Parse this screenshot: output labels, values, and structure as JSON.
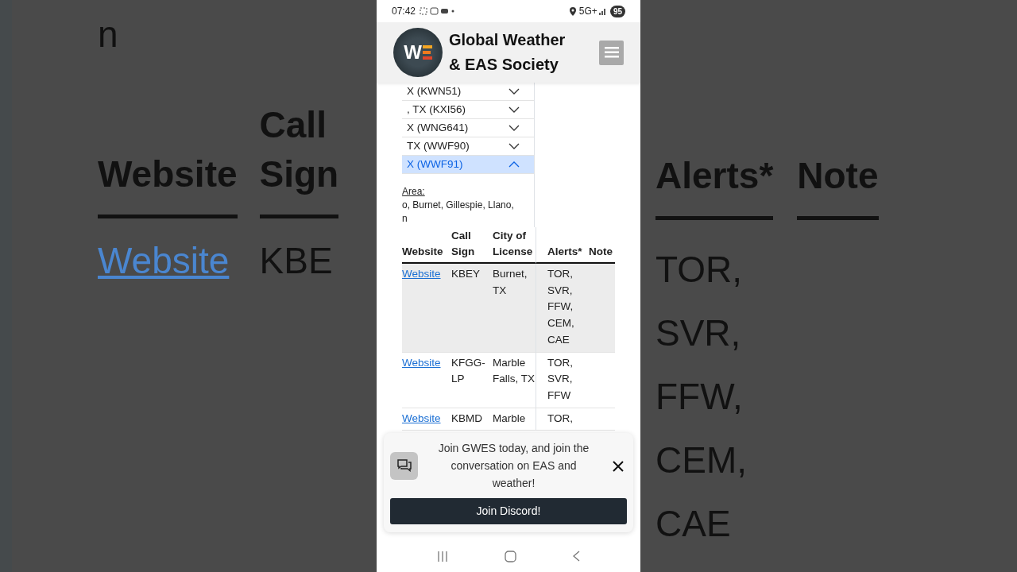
{
  "backdrop_left": {
    "fragment": "n",
    "columns": [
      {
        "header_lines": [
          "Website"
        ],
        "cell": "Website",
        "link": true
      },
      {
        "header_lines": [
          "Call",
          "Sign"
        ],
        "cell": "KBE",
        "link": false
      }
    ]
  },
  "backdrop_right": {
    "columns": [
      {
        "header": "Alerts*",
        "cell_lines": [
          "TOR,",
          "SVR,",
          "FFW,",
          "CEM,",
          "CAE"
        ]
      },
      {
        "header": "Note"
      }
    ]
  },
  "status_bar": {
    "time": "07:42",
    "network": "5G+",
    "battery": "95"
  },
  "header": {
    "logo_letter": "W",
    "title_lines": [
      "Global Weather",
      "& EAS Society"
    ]
  },
  "accordion": [
    {
      "label": "X (KWN51)",
      "expanded": false
    },
    {
      "label": ", TX (KXI56)",
      "expanded": false
    },
    {
      "label": "X (WNG641)",
      "expanded": false
    },
    {
      "label": "TX (WWF90)",
      "expanded": false
    },
    {
      "label": "X (WWF91)",
      "expanded": true
    }
  ],
  "area": {
    "label": "Area:",
    "lines": [
      "o, Burnet, Gillespie, Llano,",
      "n"
    ]
  },
  "table": {
    "columns": [
      "Website",
      "Call Sign",
      "City of License",
      "Alerts*",
      "Note"
    ],
    "rows": [
      {
        "website": "Website",
        "call_sign_lines": [
          "KBEY"
        ],
        "city_lines": [
          "Burnet,",
          "TX"
        ],
        "alerts_lines": [
          "TOR,",
          "SVR,",
          "FFW,",
          "CEM,",
          "CAE"
        ],
        "shaded": true
      },
      {
        "website": "Website",
        "call_sign_lines": [
          "KFGG-",
          "LP"
        ],
        "city_lines": [
          "Marble",
          "Falls, TX"
        ],
        "alerts_lines": [
          "TOR,",
          "SVR,",
          "FFW"
        ],
        "shaded": false
      },
      {
        "website": "Website",
        "call_sign_lines": [
          "KBMD"
        ],
        "city_lines": [
          "Marble"
        ],
        "alerts_lines": [
          "TOR,"
        ],
        "shaded": false
      }
    ]
  },
  "popup": {
    "message": "Join GWES today, and join the conversation on EAS and weather!",
    "button": "Join Discord!"
  }
}
